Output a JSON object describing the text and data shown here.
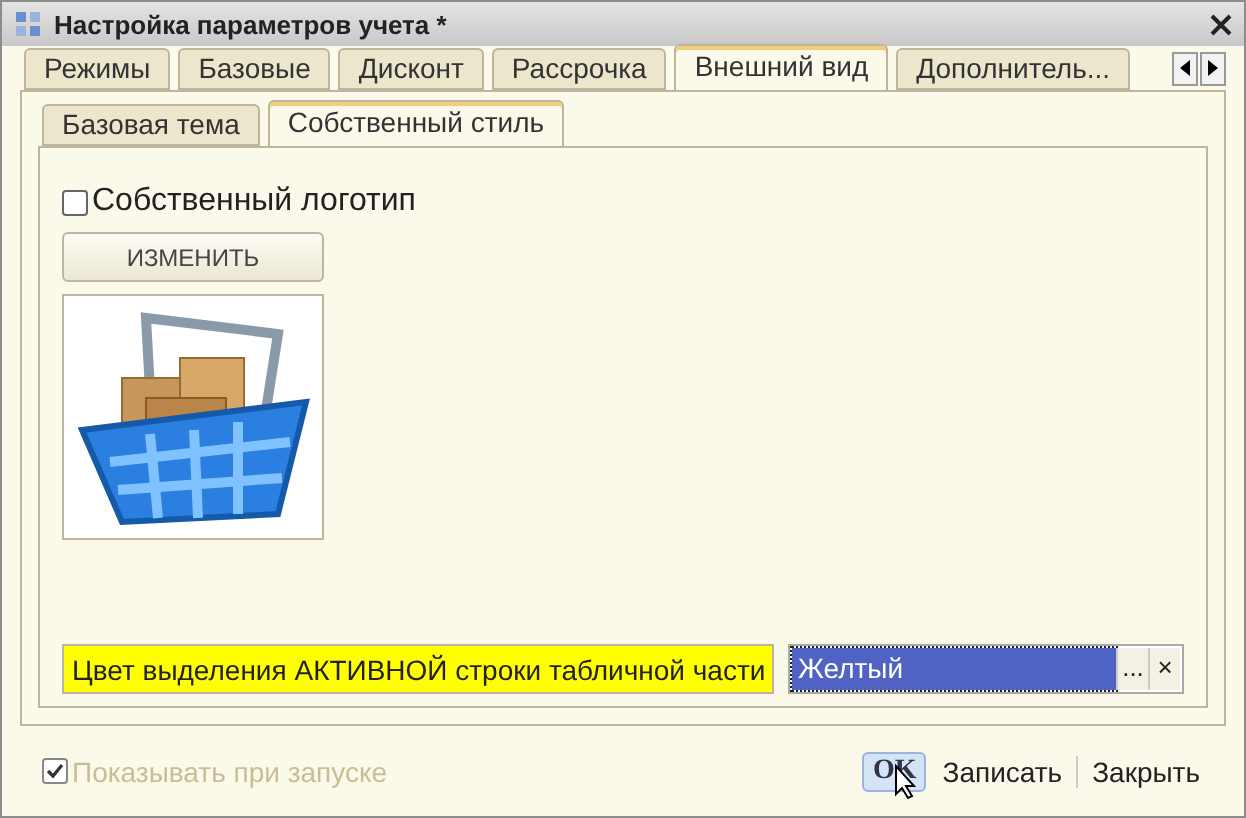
{
  "window": {
    "title": "Настройка параметров учета *"
  },
  "tabs": [
    {
      "label": "Режимы",
      "selected": false
    },
    {
      "label": "Базовые",
      "selected": false
    },
    {
      "label": "Дисконт",
      "selected": false
    },
    {
      "label": "Рассрочка",
      "selected": false
    },
    {
      "label": "Внешний вид",
      "selected": true
    },
    {
      "label": "Дополнитель...",
      "selected": false
    }
  ],
  "subtabs": [
    {
      "label": "Базовая тема",
      "selected": false
    },
    {
      "label": "Собственный стиль",
      "selected": true
    }
  ],
  "own_logo": {
    "label": "Собственный логотип",
    "checked": false
  },
  "change_button": {
    "label": "ИЗМЕНИТЬ"
  },
  "color_setting": {
    "label": "Цвет выделения АКТИВНОЙ строки табличной части",
    "value": "Желтый",
    "choose": "...",
    "clear": "×"
  },
  "show_on_start": {
    "label": "Показывать при запуске",
    "checked": true,
    "disabled": true
  },
  "buttons": [
    {
      "label": "OK",
      "kind": "default"
    },
    {
      "label": "Записать",
      "kind": "plain"
    },
    {
      "label": "Закрыть",
      "kind": "plain"
    }
  ]
}
